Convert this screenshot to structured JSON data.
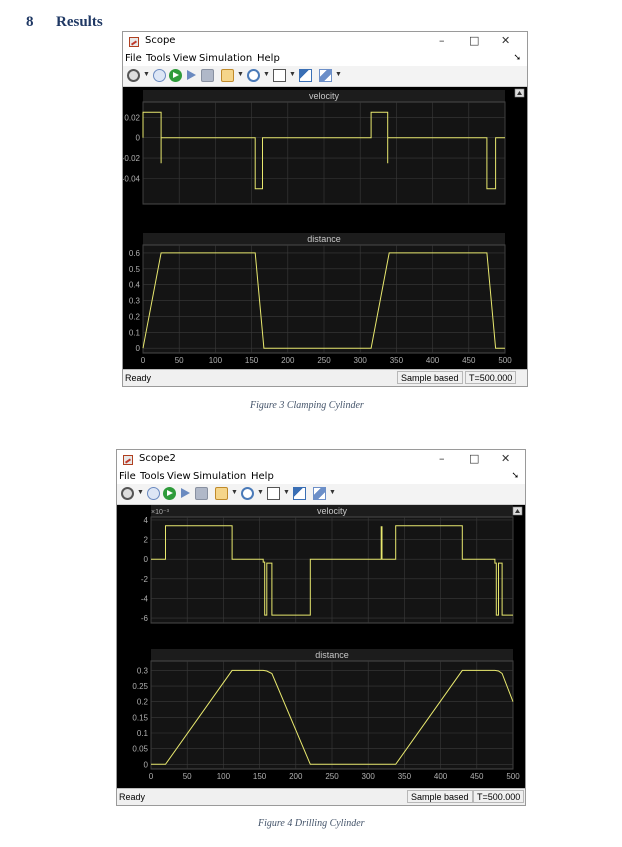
{
  "heading": {
    "number": "8",
    "text": "Results"
  },
  "menu_items": [
    "File",
    "Tools",
    "View",
    "Simulation",
    "Help"
  ],
  "window_controls": {
    "minimize": "–",
    "maximize": "□",
    "close": "✕"
  },
  "toolbar_icons": [
    "gear-icon",
    "step-back-icon",
    "run-icon",
    "step-forward-icon",
    "stop-icon",
    "configure-icon",
    "zoom-icon",
    "fit-axes-icon",
    "cursor-icon",
    "highlight-icon"
  ],
  "colors": {
    "plot_bg": "#000000",
    "axes_bg": "#141414",
    "trace": "#e8e86e",
    "grid": "#3a3a3a",
    "tick_text": "#b0b0b0"
  },
  "figures": [
    {
      "window_title": "Scope",
      "caption": "Figure 3 Clamping Cylinder",
      "status": {
        "ready": "Ready",
        "mode": "Sample based",
        "time": "T=500.000"
      }
    },
    {
      "window_title": "Scope2",
      "caption": "Figure 4 Drilling Cylinder",
      "status": {
        "ready": "Ready",
        "mode": "Sample based",
        "time": "T=500.000"
      }
    }
  ],
  "chart_data": [
    {
      "type": "line",
      "title": "velocity",
      "xlim": [
        0,
        500
      ],
      "ylim": [
        -0.065,
        0.035
      ],
      "yticks": [
        0.02,
        0,
        -0.02,
        -0.04
      ],
      "ytick_labels": [
        "0.02",
        "0",
        "-0.02",
        "-0.04"
      ],
      "xticks": [
        0,
        50,
        100,
        150,
        200,
        250,
        300,
        350,
        400,
        450,
        500
      ],
      "grid": true,
      "x": [
        0,
        0,
        25,
        25,
        25,
        25,
        25,
        155,
        155,
        165,
        165,
        315,
        315,
        338,
        338,
        338,
        338,
        338,
        475,
        475,
        487,
        487,
        500
      ],
      "y": [
        0,
        0.025,
        0.025,
        -0.025,
        0.025,
        0,
        0,
        0,
        -0.05,
        -0.05,
        0,
        0,
        0.025,
        0.025,
        -0.025,
        0.025,
        0,
        0,
        0,
        -0.05,
        -0.05,
        0,
        0
      ]
    },
    {
      "type": "line",
      "title": "distance",
      "xlim": [
        0,
        500
      ],
      "ylim": [
        -0.03,
        0.65
      ],
      "yticks": [
        0,
        0.1,
        0.2,
        0.3,
        0.4,
        0.5,
        0.6
      ],
      "ytick_labels": [
        "0",
        "0.1",
        "0.2",
        "0.3",
        "0.4",
        "0.5",
        "0.6"
      ],
      "xticks": [
        0,
        50,
        100,
        150,
        200,
        250,
        300,
        350,
        400,
        450,
        500
      ],
      "xtick_labels": [
        "0",
        "50",
        "100",
        "150",
        "200",
        "250",
        "300",
        "350",
        "400",
        "450",
        "500"
      ],
      "grid": true,
      "x": [
        0,
        25,
        155,
        167,
        315,
        340,
        475,
        487,
        500
      ],
      "y": [
        0,
        0.6,
        0.6,
        0,
        0,
        0.6,
        0.6,
        0,
        0
      ]
    },
    {
      "type": "line",
      "title": "velocity",
      "exponent_label": "×10⁻³",
      "xlim": [
        0,
        500
      ],
      "ylim": [
        -6.5,
        4.3
      ],
      "yticks": [
        4,
        2,
        0,
        -2,
        -4,
        -6
      ],
      "ytick_labels": [
        "4",
        "2",
        "0",
        "-2",
        "-4",
        "-6"
      ],
      "xticks": [
        0,
        50,
        100,
        150,
        200,
        250,
        300,
        350,
        400,
        450,
        500
      ],
      "grid": true,
      "x": [
        0,
        20,
        20,
        112,
        112,
        155,
        155,
        157,
        157,
        160,
        160,
        167,
        167,
        220,
        220,
        318,
        318,
        319,
        319,
        338,
        338,
        430,
        430,
        475,
        475,
        477,
        477,
        480,
        480,
        485,
        485,
        500
      ],
      "y": [
        0,
        0,
        3.4,
        3.4,
        0,
        0,
        -0.3,
        -0.3,
        -5.7,
        -5.7,
        -0.4,
        -0.4,
        -5.7,
        -5.7,
        0,
        0,
        3.3,
        3.3,
        0,
        0,
        3.4,
        3.4,
        0,
        0,
        -0.4,
        -0.4,
        -5.7,
        -5.7,
        -0.4,
        -0.4,
        -5.7,
        -5.7
      ]
    },
    {
      "type": "line",
      "title": "distance",
      "xlim": [
        0,
        500
      ],
      "ylim": [
        -0.015,
        0.33
      ],
      "yticks": [
        0,
        0.05,
        0.1,
        0.15,
        0.2,
        0.25,
        0.3
      ],
      "ytick_labels": [
        "0",
        "0.05",
        "0.1",
        "0.15",
        "0.2",
        "0.25",
        "0.3"
      ],
      "xticks": [
        0,
        50,
        100,
        150,
        200,
        250,
        300,
        350,
        400,
        450,
        500
      ],
      "xtick_labels": [
        "0",
        "50",
        "100",
        "150",
        "200",
        "250",
        "300",
        "350",
        "400",
        "450",
        "500"
      ],
      "grid": true,
      "x": [
        0,
        20,
        112,
        155,
        160,
        167,
        220,
        338,
        430,
        475,
        480,
        485,
        500
      ],
      "y": [
        0,
        0,
        0.3,
        0.3,
        0.298,
        0.29,
        0,
        0,
        0.3,
        0.3,
        0.298,
        0.29,
        0.2
      ]
    }
  ]
}
